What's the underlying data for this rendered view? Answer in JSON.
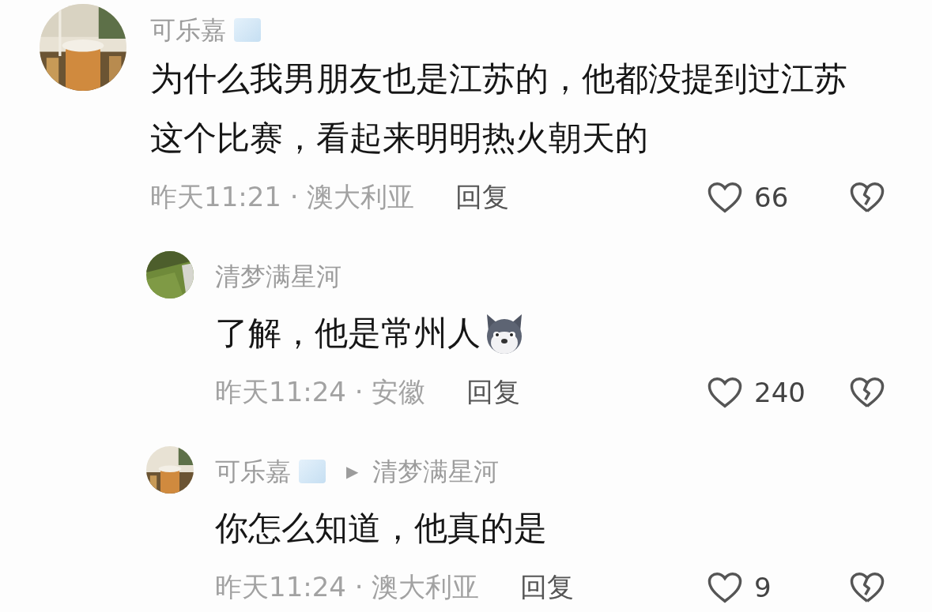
{
  "comments": [
    {
      "name": "可乐嘉",
      "badge": true,
      "text": "为什么我男朋友也是江苏的，他都没提到过江苏这个比赛，看起来明明热火朝天的",
      "sticker": false,
      "meta": "昨天11:21 · 澳大利亚",
      "reply_label": "回复",
      "likes": "66",
      "liked": false,
      "replies": [
        {
          "name": "清梦满星河",
          "badge": false,
          "text": "了解，他是常州人",
          "sticker": true,
          "meta": "昨天11:24 · 安徽",
          "reply_label": "回复",
          "likes": "240",
          "liked": false
        },
        {
          "name": "可乐嘉",
          "badge": true,
          "reply_to": {
            "arrow": "▶",
            "name": "清梦满星河"
          },
          "text": "你怎么知道，他真的是",
          "sticker": false,
          "meta": "昨天11:24 · 澳大利亚",
          "reply_label": "回复",
          "likes": "9",
          "liked": false
        }
      ]
    }
  ]
}
